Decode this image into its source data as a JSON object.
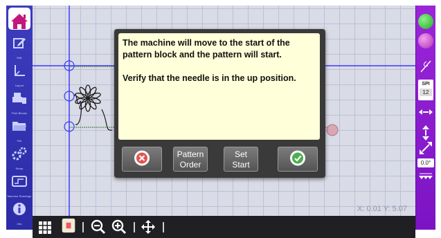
{
  "sidebar": {
    "items": [
      {
        "label": "Home",
        "icon": "home-icon"
      },
      {
        "label": "Edit",
        "icon": "edit-icon"
      },
      {
        "label": "Layout",
        "icon": "layout-icon"
      },
      {
        "label": "Print Blocks",
        "icon": "print-blocks-icon"
      },
      {
        "label": "File",
        "icon": "folder-icon"
      },
      {
        "label": "Setup",
        "icon": "setup-icon"
      },
      {
        "label": "Machine Readings",
        "icon": "machine-icon"
      },
      {
        "label": "Info",
        "icon": "info-icon"
      }
    ]
  },
  "dialog": {
    "message_line1": "The machine will move to the start of the pattern block and the pattern will start.",
    "message_line2": "Verify that the needle is in the up position.",
    "cancel_icon": "cancel-icon",
    "pattern_order_label_1": "Pattern",
    "pattern_order_label_2": "Order",
    "set_start_label_1": "Set",
    "set_start_label_2": "Start",
    "confirm_icon": "check-icon"
  },
  "canvas": {
    "coordinates": "X: 0.01 Y: 5.07"
  },
  "right_bar": {
    "spi_label": "SPI",
    "spi_value": "12",
    "angle_value": "0.0°",
    "start_color": "#33cc33",
    "stop_color": "#cc44cc"
  },
  "bottom_bar": {
    "tools": [
      "grid-icon",
      "pattern-swatch-icon",
      "zoom-out-icon",
      "zoom-in-icon",
      "pan-icon"
    ]
  }
}
